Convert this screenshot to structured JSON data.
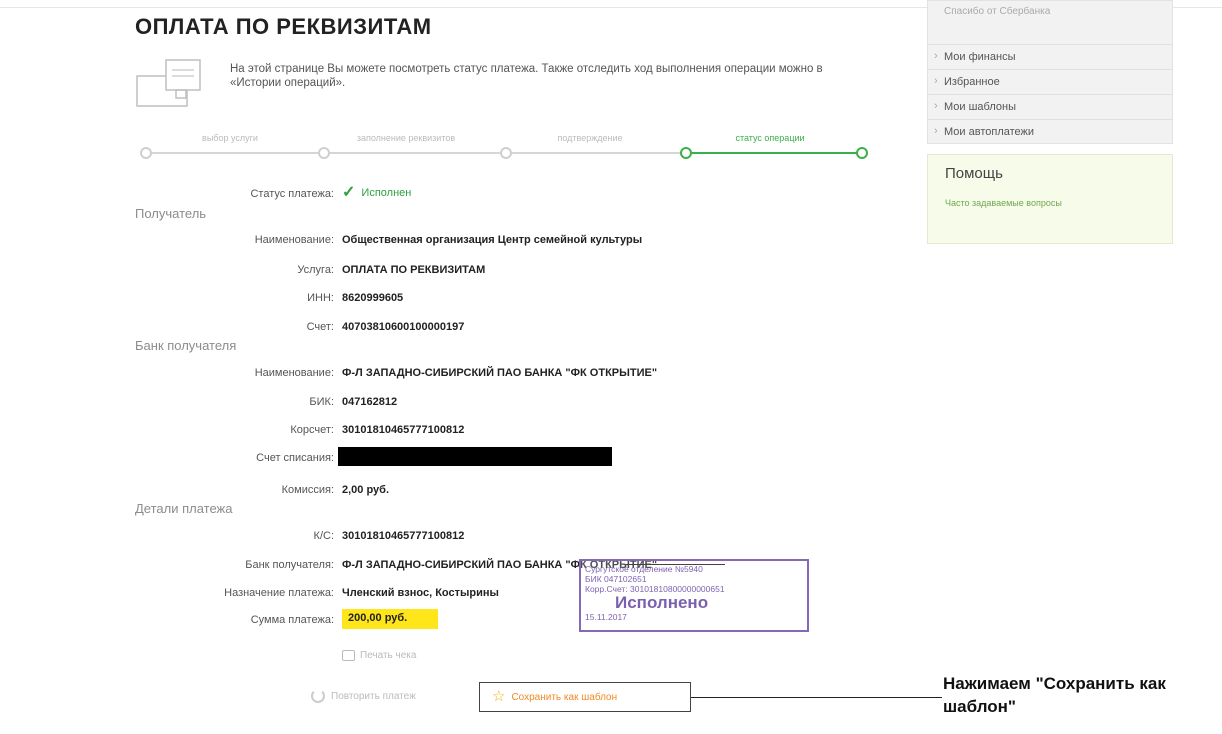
{
  "page": {
    "title": "ОПЛАТА ПО РЕКВИЗИТАМ",
    "intro": "На этой странице Вы можете посмотреть статус платежа. Также отследить ход выполнения операции можно в «Истории операций»."
  },
  "stepper": {
    "steps": [
      "выбор услуги",
      "заполнение реквизитов",
      "подтверждение",
      "статус операции"
    ],
    "active_index": 3,
    "active_color": "#3bb04a"
  },
  "status": {
    "label": "Статус платежа:",
    "value": "Исполнен"
  },
  "recipient": {
    "section": "Получатель",
    "name_label": "Наименование:",
    "name": "Общественная организация Центр семейной культуры",
    "service_label": "Услуга:",
    "service": "ОПЛАТА ПО РЕКВИЗИТАМ",
    "inn_label": "ИНН:",
    "inn": "8620999605",
    "account_label": "Счет:",
    "account": "40703810600100000197"
  },
  "bank": {
    "section": "Банк получателя",
    "name_label": "Наименование:",
    "name": "Ф-Л ЗАПАДНО-СИБИРСКИЙ ПАО БАНКА \"ФК ОТКРЫТИЕ\"",
    "bik_label": "БИК:",
    "bik": "047162812",
    "corr_label": "Корсчет:",
    "corr": "30101810465777100812",
    "debit_label": "Счет списания:",
    "commission_label": "Комиссия:",
    "commission": "2,00 руб."
  },
  "details": {
    "section": "Детали платежа",
    "ks_label": "К/С:",
    "ks": "30101810465777100812",
    "bank_label": "Банк получателя:",
    "bank": "Ф-Л ЗАПАДНО-СИБИРСКИЙ ПАО БАНКА \"ФК ОТКРЫТИЕ\"",
    "purpose_label": "Назначение платежа:",
    "purpose": "Членский взнос, Костырины",
    "sum_label": "Сумма платежа:",
    "sum": "200,00 руб."
  },
  "stamp": {
    "line1": "Сургутское отделение №5940",
    "line2": "БИК 047102651",
    "line3": "Корр.Счет: 30101810800000000651",
    "big": "Исполнено",
    "date": "15.11.2017"
  },
  "actions": {
    "print": "Печать чека",
    "repeat": "Повторить платеж",
    "save_template": "Сохранить как шаблон"
  },
  "callout": {
    "text": "Нажимаем \"Сохранить как шаблон\""
  },
  "sidebar": {
    "top_item": "Спасибо от Сбербанка",
    "items": [
      "Мои финансы",
      "Избранное",
      "Мои шаблоны",
      "Мои автоплатежи"
    ],
    "help_title": "Помощь",
    "help_link": "Часто задаваемые вопросы"
  }
}
